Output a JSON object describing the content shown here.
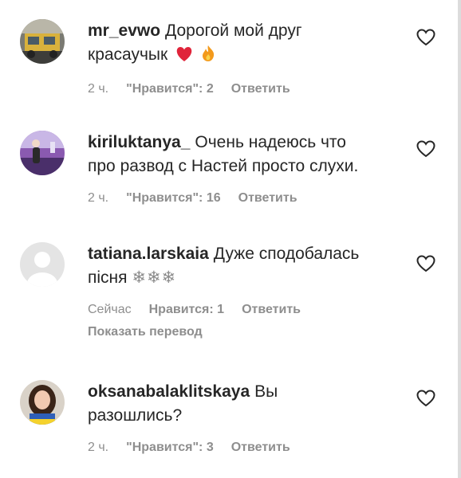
{
  "comments": [
    {
      "username": "mr_evwo",
      "text_line1": "Дорогой мой друг",
      "text_line2": "красаучык",
      "time": "2 ч.",
      "likes": "\"Нравится\": 2",
      "reply": "Ответить",
      "emoji": [
        "red-heart-icon",
        "fire-icon"
      ]
    },
    {
      "username": "kiriluktanya_",
      "text_line1": "Очень надеюсь что",
      "text_line2": "про развод с Настей просто слухи.",
      "time": "2 ч.",
      "likes": "\"Нравится\": 16",
      "reply": "Ответить"
    },
    {
      "username": "tatiana.larskaia",
      "text_line1": "Дуже сподобалась",
      "text_line2": "пісня",
      "snowflakes": "❄❄❄",
      "time": "Сейчас",
      "likes": "Нравится: 1",
      "reply": "Ответить",
      "translate": "Показать перевод"
    },
    {
      "username": "oksanabalaklitskaya",
      "text_line1": "Вы",
      "text_line2": "разошлись?",
      "time": "2 ч.",
      "likes": "\"Нравится\": 3",
      "reply": "Ответить"
    }
  ],
  "colors": {
    "text": "#262626",
    "meta": "#8e8e8e",
    "heart_emoji": "#e0243a",
    "fire_emoji": "#f39a1c"
  },
  "icons": {
    "like": "heart-outline-icon"
  }
}
